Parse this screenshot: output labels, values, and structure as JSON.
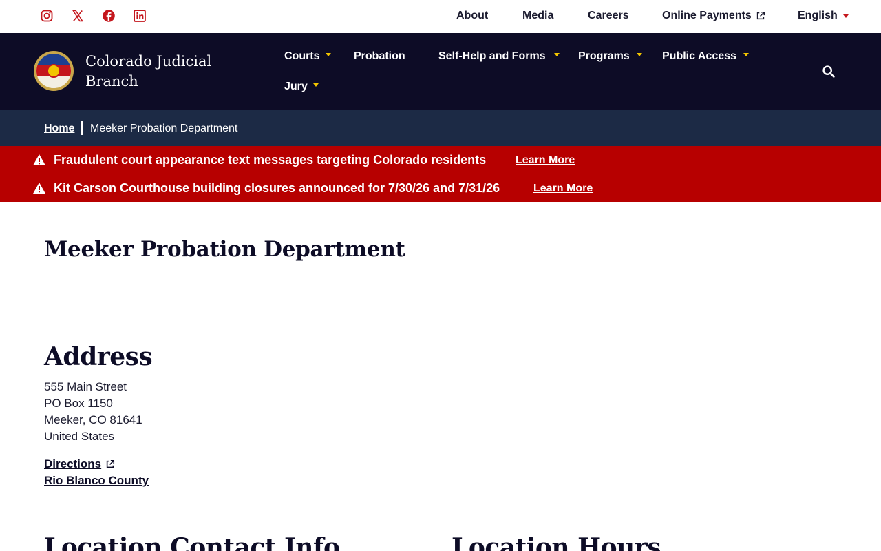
{
  "social": {
    "icons": [
      "instagram-icon",
      "x-icon",
      "facebook-icon",
      "linkedin-icon"
    ],
    "color": "#c4161c"
  },
  "utility_nav": {
    "about": "About",
    "media": "Media",
    "careers": "Careers",
    "online_payments": "Online Payments",
    "language": "English"
  },
  "brand": {
    "name": "Colorado Judicial Branch"
  },
  "main_nav": {
    "courts": "Courts",
    "probation": "Probation",
    "self_help": "Self-Help and Forms",
    "programs": "Programs",
    "public_access": "Public Access",
    "jury": "Jury"
  },
  "breadcrumb": {
    "home": "Home",
    "current": "Meeker Probation Department"
  },
  "alerts": [
    {
      "text": "Fraudulent court appearance text messages targeting Colorado residents",
      "link": "Learn More"
    },
    {
      "text": "Kit Carson Courthouse building closures announced for 7/30/26 and 7/31/26",
      "link": "Learn More"
    }
  ],
  "content": {
    "title": "Meeker Probation Department",
    "address_heading": "Address",
    "address_lines": [
      "555 Main Street",
      "PO Box 1150",
      "Meeker, CO 81641",
      "United States"
    ],
    "directions": "Directions",
    "county": "Rio Blanco County",
    "contact_heading": "Location Contact Info",
    "hours_heading": "Location Hours"
  },
  "colors": {
    "nav_bg": "#0d0c26",
    "breadcrumb_bg": "#1c2a45",
    "alert_bg": "#b70000",
    "accent_gold": "#f2c500",
    "accent_red": "#c4161c"
  }
}
